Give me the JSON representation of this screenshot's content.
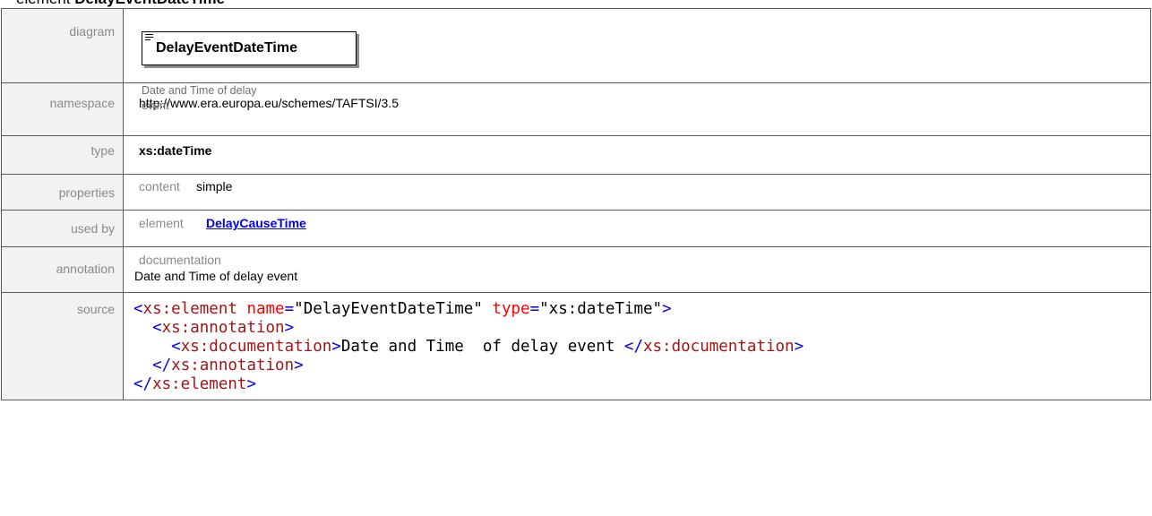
{
  "header": {
    "prefix": "element ",
    "name": "DelayEventDateTime"
  },
  "rows": {
    "diagram": {
      "label": "diagram",
      "element_name": "DelayEventDateTime",
      "caption": "Date and Time  of delay event"
    },
    "namespace": {
      "label": "namespace",
      "value": "http://www.era.europa.eu/schemes/TAFTSI/3.5"
    },
    "type": {
      "label": "type",
      "value": "xs:dateTime"
    },
    "properties": {
      "label": "properties",
      "key": "content",
      "value": "simple"
    },
    "used_by": {
      "label": "used by",
      "key": "element",
      "link": "DelayCauseTime"
    },
    "annotation": {
      "label": "annotation",
      "key": "documentation",
      "value": "Date and Time  of delay event"
    },
    "source": {
      "label": "source",
      "line1": {
        "open": "<",
        "tag": "xs:element",
        "attr1": "name",
        "eq1": "=",
        "val1": "\"DelayEventDateTime\"",
        "attr2": "type",
        "eq2": "=",
        "val2": "\"xs:dateTime\"",
        "close": ">"
      },
      "line2": {
        "open": "<",
        "tag": "xs:annotation",
        "close": ">"
      },
      "line3": {
        "open": "<",
        "tag": "xs:documentation",
        "close": ">",
        "text": "Date and Time  of delay event ",
        "end_open": "</",
        "end_tag": "xs:documentation",
        "end_close": ">"
      },
      "line4": {
        "open": "</",
        "tag": "xs:annotation",
        "close": ">"
      },
      "line5": {
        "open": "</",
        "tag": "xs:element",
        "close": ">"
      }
    }
  }
}
